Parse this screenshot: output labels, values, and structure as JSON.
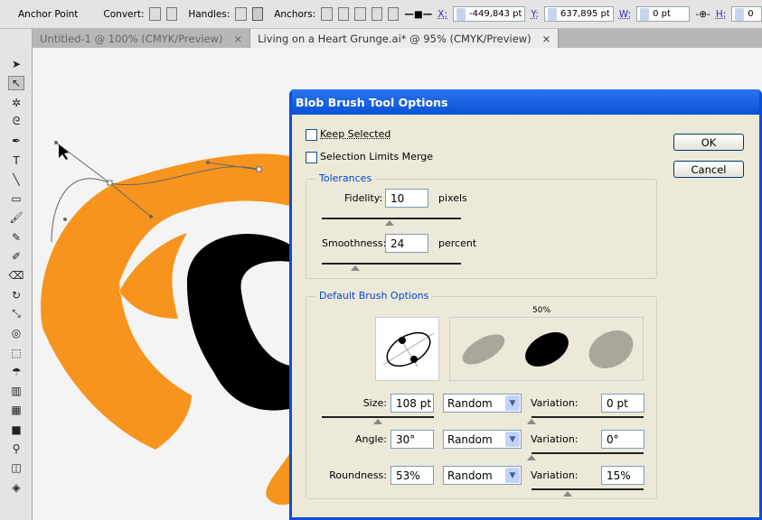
{
  "control_bar": {
    "tool_name": "Anchor Point",
    "convert_label": "Convert:",
    "handles_label": "Handles:",
    "anchors_label": "Anchors:",
    "x_label": "X:",
    "x_value": "-449,843 pt",
    "y_label": "Y:",
    "y_value": "637,895 pt",
    "w_label": "W:",
    "w_value": "0 pt",
    "h_label": "H:",
    "h_value": "0"
  },
  "tabs": [
    {
      "label": "Untitled-1 @ 100% (CMYK/Preview)",
      "close": "×",
      "active": false
    },
    {
      "label": "Living on a Heart Grunge.ai* @ 95% (CMYK/Preview)",
      "close": "×",
      "active": true
    }
  ],
  "tools": [
    "selection",
    "direct-selection",
    "magic-wand",
    "lasso",
    "pen",
    "type",
    "line",
    "rectangle",
    "paintbrush",
    "pencil",
    "blob-brush",
    "eraser",
    "rotate",
    "scale",
    "warp",
    "free-transform",
    "symbol-sprayer",
    "column-graph",
    "mesh",
    "gradient",
    "eyedropper",
    "blend",
    "live-paint-bucket"
  ],
  "colors": {
    "artwork_orange": "#f7941d",
    "artwork_black": "#000000",
    "dialog_title": "#0a4fd8",
    "dialog_bg": "#ece9d8"
  },
  "dialog": {
    "title": "Blob Brush Tool Options",
    "keep_selected": {
      "label": "Keep Selected",
      "checked": false
    },
    "selection_limits_merge": {
      "label": "Selection Limits Merge",
      "checked": false
    },
    "ok": "OK",
    "cancel": "Cancel",
    "tolerances": {
      "legend": "Tolerances",
      "fidelity_label": "Fidelity:",
      "fidelity_value": "10",
      "fidelity_unit": "pixels",
      "fidelity_slider": 0.49,
      "smoothness_label": "Smoothness:",
      "smoothness_value": "24",
      "smoothness_unit": "percent",
      "smoothness_slider": 0.24
    },
    "brush": {
      "legend": "Default Brush Options",
      "preview_label": "50%",
      "size": {
        "label": "Size:",
        "value": "108 pt",
        "mode": "Random",
        "variation_label": "Variation:",
        "variation": "0 pt",
        "slider": 0.5,
        "variation_slider": 0
      },
      "angle": {
        "label": "Angle:",
        "value": "30°",
        "mode": "Random",
        "variation_label": "Variation:",
        "variation": "0°",
        "variation_slider": 0
      },
      "roundness": {
        "label": "Roundness:",
        "value": "53%",
        "mode": "Random",
        "variation_label": "Variation:",
        "variation": "15%",
        "variation_slider": 0.32
      }
    }
  }
}
